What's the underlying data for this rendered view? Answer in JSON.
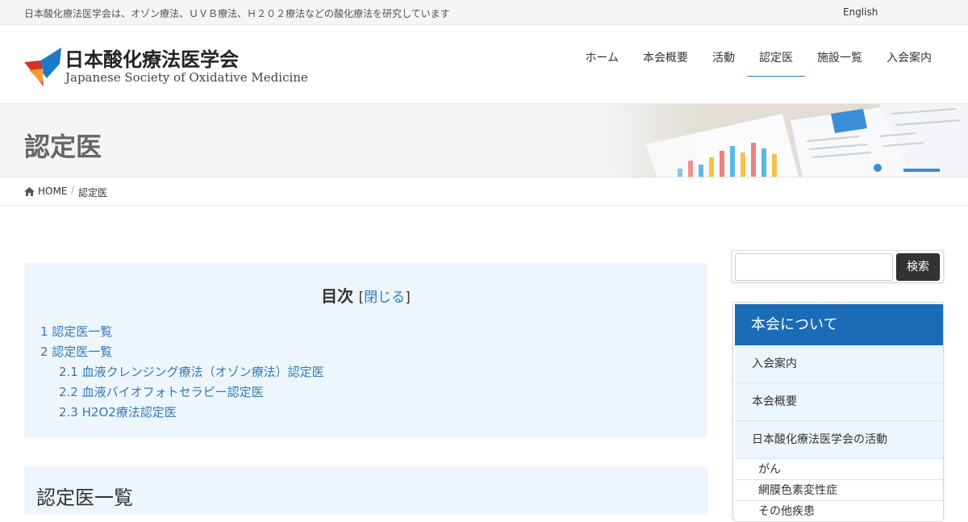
{
  "topbar": {
    "tagline": "日本酸化療法医学会は、オゾン療法、ＵＶＢ療法、Ｈ２０２療法などの酸化療法を研究しています",
    "lang_link": "English"
  },
  "logo": {
    "jp": "日本酸化療法医学会",
    "en": "Japanese Society of Oxidative Medicine",
    "colors": {
      "blue": "#1a7bc9",
      "red": "#d9322a",
      "orange": "#f0a030"
    }
  },
  "nav": {
    "items": [
      {
        "label": "ホーム"
      },
      {
        "label": "本会概要"
      },
      {
        "label": "活動"
      },
      {
        "label": "認定医",
        "active": true
      },
      {
        "label": "施設一覧"
      },
      {
        "label": "入会案内"
      }
    ],
    "active_color": "#337ab7"
  },
  "banner": {
    "title": "認定医"
  },
  "breadcrumb": {
    "home": "HOME",
    "separator": "/",
    "current": "認定医",
    "home_icon": "home-icon"
  },
  "toc": {
    "title": "目次",
    "bracket_open": "[",
    "toggle_label": "閉じる",
    "bracket_close": "]",
    "items": [
      {
        "label": "1 認定医一覧",
        "level": 1
      },
      {
        "label": "2 認定医一覧",
        "level": 1
      },
      {
        "label": "2.1 血液クレンジング療法（オゾン療法）認定医",
        "level": 2
      },
      {
        "label": "2.2 血液バイオフォトセラピー認定医",
        "level": 2
      },
      {
        "label": "2.3 H2O2療法認定医",
        "level": 2
      }
    ]
  },
  "section": {
    "heading": "認定医一覧"
  },
  "search": {
    "placeholder": "",
    "value": "",
    "button_label": "検索"
  },
  "sidebar": {
    "heading": "本会について",
    "header_color": "#1a6cb7",
    "items": [
      {
        "label": "入会案内"
      },
      {
        "label": "本会概要"
      },
      {
        "label": "日本酸化療法医学会の活動"
      }
    ],
    "sub_items": [
      {
        "label": "がん"
      },
      {
        "label": "網膜色素変性症"
      },
      {
        "label": "その他疾患"
      }
    ]
  }
}
